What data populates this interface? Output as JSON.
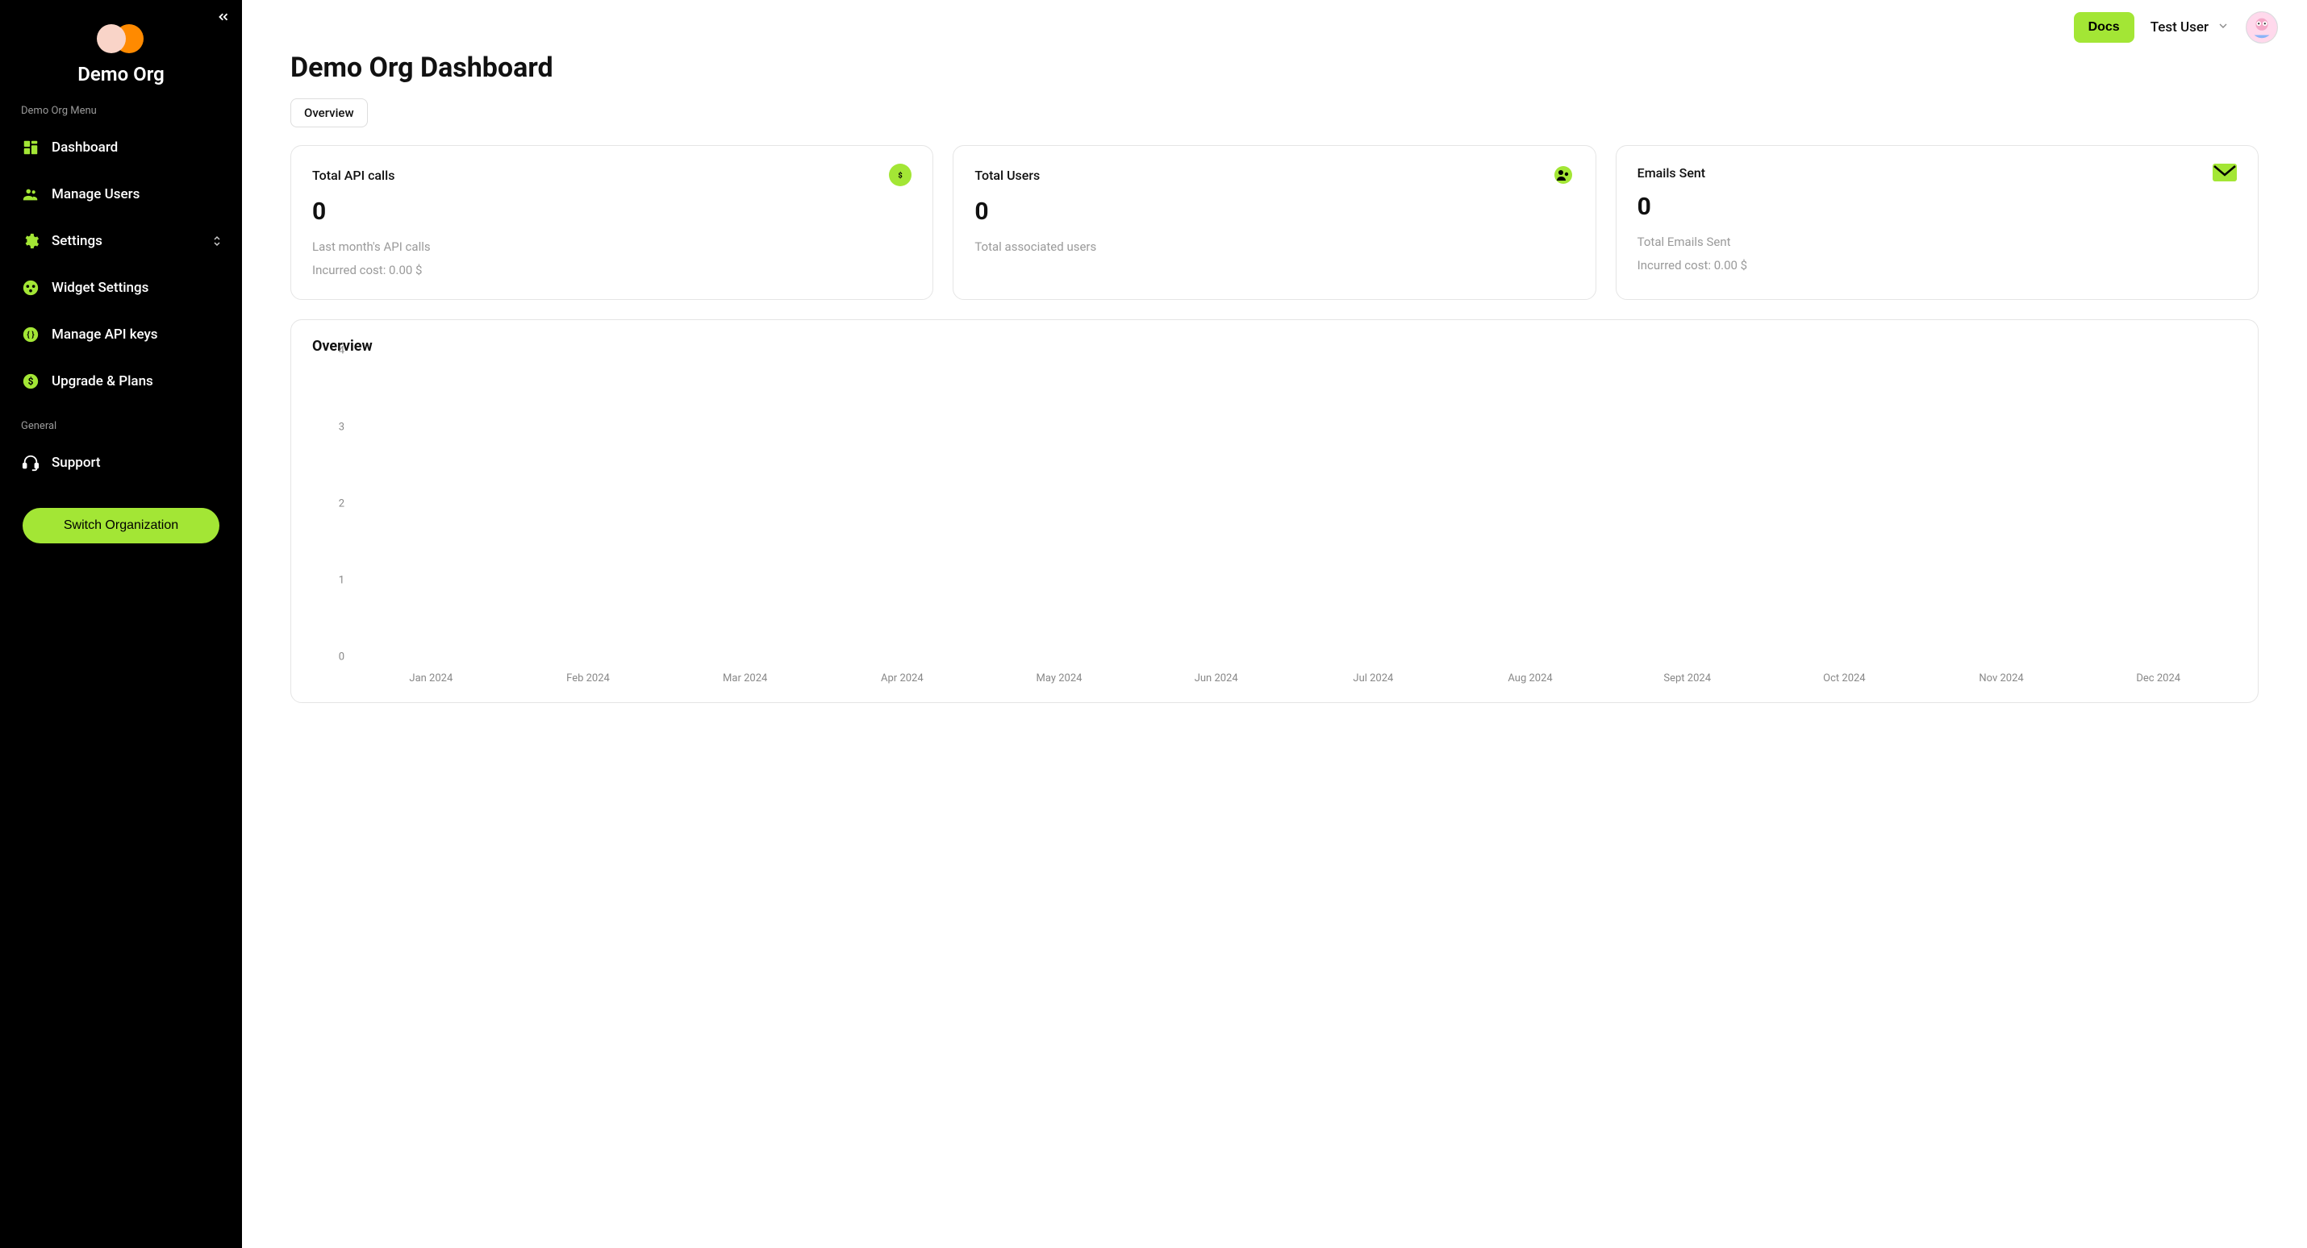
{
  "sidebar": {
    "org_name": "Demo Org",
    "menu_label": "Demo Org Menu",
    "items": [
      {
        "label": "Dashboard",
        "icon": "dashboard-icon"
      },
      {
        "label": "Manage Users",
        "icon": "users-icon"
      },
      {
        "label": "Settings",
        "icon": "gear-icon",
        "expandable": true
      },
      {
        "label": "Widget Settings",
        "icon": "widget-icon"
      },
      {
        "label": "Manage API keys",
        "icon": "api-icon"
      },
      {
        "label": "Upgrade & Plans",
        "icon": "dollar-icon"
      }
    ],
    "general_label": "General",
    "support_label": "Support",
    "switch_org_label": "Switch Organization"
  },
  "topbar": {
    "docs_label": "Docs",
    "user_name": "Test User"
  },
  "page": {
    "title": "Demo Org Dashboard",
    "tab_overview": "Overview"
  },
  "cards": {
    "api": {
      "title": "Total API calls",
      "value": "0",
      "sub1": "Last month's API calls",
      "sub2": "Incurred cost: 0.00 $"
    },
    "users": {
      "title": "Total Users",
      "value": "0",
      "sub1": "Total associated users"
    },
    "emails": {
      "title": "Emails Sent",
      "value": "0",
      "sub1": "Total Emails Sent",
      "sub2": "Incurred cost: 0.00 $"
    }
  },
  "chart": {
    "title": "Overview"
  },
  "chart_data": {
    "type": "bar",
    "categories": [
      "Jan 2024",
      "Feb 2024",
      "Mar 2024",
      "Apr 2024",
      "May 2024",
      "Jun 2024",
      "Jul 2024",
      "Aug 2024",
      "Sept 2024",
      "Oct 2024",
      "Nov 2024",
      "Dec 2024"
    ],
    "values": [
      0,
      0,
      0,
      0,
      0,
      0,
      0,
      0,
      0,
      0,
      0,
      0
    ],
    "y_ticks": [
      0,
      1,
      2,
      3,
      4
    ],
    "ylim": [
      0,
      4
    ]
  },
  "colors": {
    "accent": "#a3e635",
    "sidebar_bg": "#000000"
  }
}
